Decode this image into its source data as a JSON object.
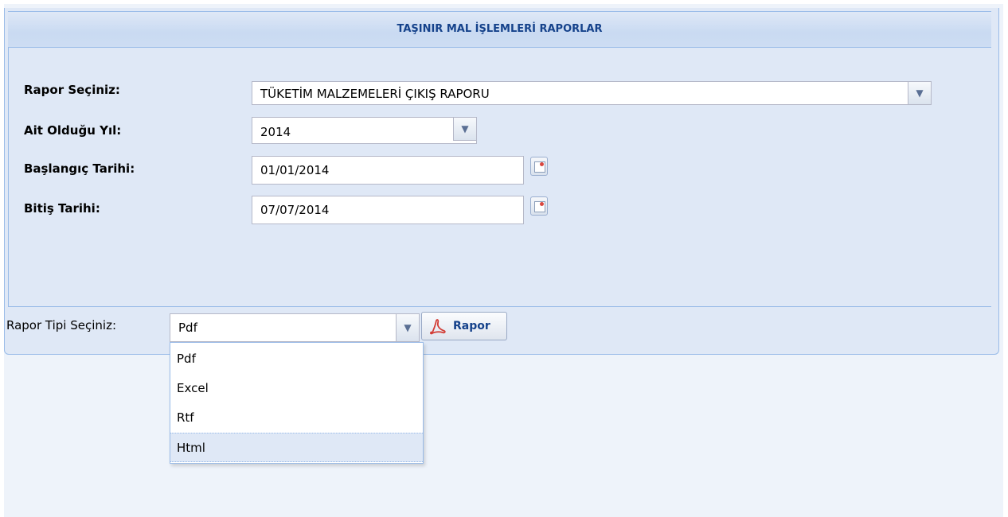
{
  "panel": {
    "title": "TAŞINIR MAL İŞLEMLERİ RAPORLAR"
  },
  "form": {
    "rapor": {
      "label": "Rapor Seçiniz",
      "value": "TÜKETİM MALZEMELERİ ÇIKIŞ RAPORU"
    },
    "yil": {
      "label": "Ait Olduğu Yıl",
      "value": "2014"
    },
    "baslangic": {
      "label": "Başlangıç Tarihi",
      "value": "01/01/2014"
    },
    "bitis": {
      "label": "Bitiş Tarihi",
      "value": "07/07/2014"
    }
  },
  "rapor_tipi": {
    "label": "Rapor Tipi Seçiniz:",
    "value": "Pdf",
    "options": [
      "Pdf",
      "Excel",
      "Rtf",
      "Html"
    ],
    "highlighted": "Html"
  },
  "button": {
    "label": "Rapor",
    "icon": "pdf-icon"
  },
  "colors": {
    "header_text": "#15428b",
    "panel_bg": "#dfe8f6",
    "border": "#99bbe8",
    "pdf_red": "#d23b34"
  }
}
